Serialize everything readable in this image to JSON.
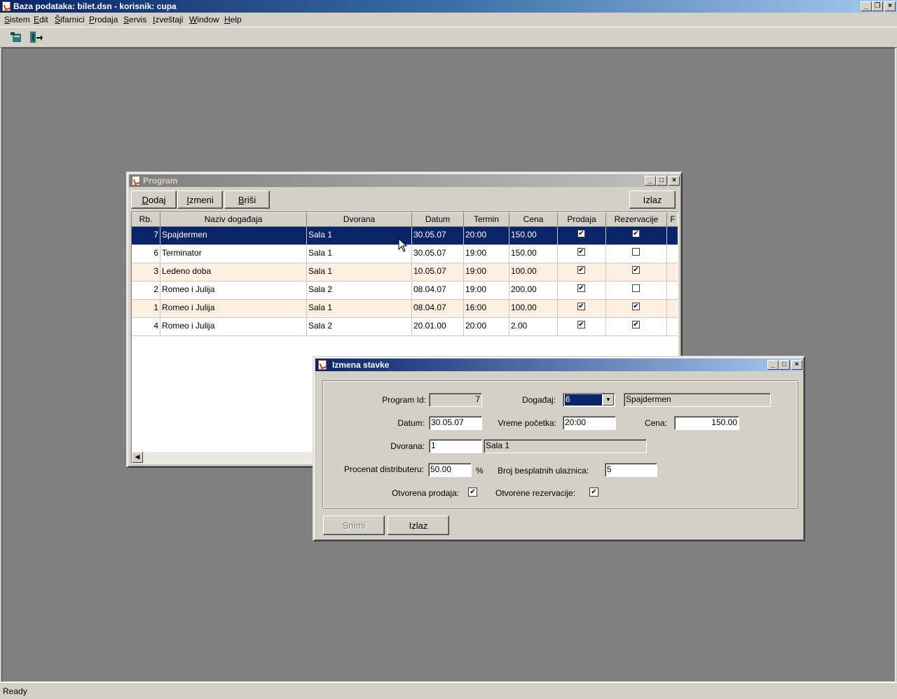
{
  "app": {
    "title": "Baza podataka: bilet.dsn  -  korisnik: cupa",
    "menu": [
      "Sistem",
      "Edit",
      "Šifarnici",
      "Prodaja",
      "Servis",
      "Izveštaji",
      "Window",
      "Help"
    ],
    "status": "Ready"
  },
  "program_window": {
    "title": "Program",
    "buttons": {
      "add": "Dodaj",
      "edit": "Izmeni",
      "delete": "Briši",
      "exit": "Izlaz"
    },
    "columns": [
      "Rb.",
      "Naziv događaja",
      "Dvorana",
      "Datum",
      "Termin",
      "Cena",
      "Prodaja",
      "Rezervacije",
      "F"
    ],
    "rows": [
      {
        "rb": "7",
        "naziv": "Spajdermen",
        "dvorana": "Sala 1",
        "datum": "30.05.07",
        "termin": "20:00",
        "cena": "150.00",
        "prodaja": true,
        "rezervacije": true
      },
      {
        "rb": "6",
        "naziv": "Terminator",
        "dvorana": "Sala 1",
        "datum": "30.05.07",
        "termin": "19:00",
        "cena": "150.00",
        "prodaja": true,
        "rezervacije": false
      },
      {
        "rb": "3",
        "naziv": "Ledeno doba",
        "dvorana": "Sala 1",
        "datum": "10.05.07",
        "termin": "19:00",
        "cena": "100.00",
        "prodaja": true,
        "rezervacije": true
      },
      {
        "rb": "2",
        "naziv": "Romeo i Julija",
        "dvorana": "Sala 2",
        "datum": "08.04.07",
        "termin": "19:00",
        "cena": "200.00",
        "prodaja": true,
        "rezervacije": false
      },
      {
        "rb": "1",
        "naziv": "Romeo i Julija",
        "dvorana": "Sala 1",
        "datum": "08.04.07",
        "termin": "16:00",
        "cena": "100.00",
        "prodaja": true,
        "rezervacije": true
      },
      {
        "rb": "4",
        "naziv": "Romeo i Julija",
        "dvorana": "Sala 2",
        "datum": "20.01.00",
        "termin": "20:00",
        "cena": "2.00",
        "prodaja": true,
        "rezervacije": true
      }
    ]
  },
  "edit_dialog": {
    "title": "Izmena stavke",
    "labels": {
      "program_id": "Program Id:",
      "dogadjaj": "Događaj:",
      "datum": "Datum:",
      "vreme": "Vreme početka:",
      "cena": "Cena:",
      "dvorana": "Dvorana:",
      "procenat": "Procenat distributeru:",
      "percent_sign": "%",
      "besplatne": "Broj besplatnih ulaznica:",
      "otv_prodaja": "Otvorena prodaja:",
      "otv_rez": "Otvorene rezervacije:"
    },
    "values": {
      "program_id": "7",
      "dogadjaj_id": "6",
      "dogadjaj_name": "Spajdermen",
      "datum": "30.05.07",
      "vreme": "20:00",
      "cena": "150.00",
      "dvorana_id": "1",
      "dvorana_name": "Sala 1",
      "procenat": "50.00",
      "besplatne": "5",
      "otv_prodaja": true,
      "otv_rez": true
    },
    "buttons": {
      "save": "Snimi",
      "exit": "Izlaz"
    }
  }
}
